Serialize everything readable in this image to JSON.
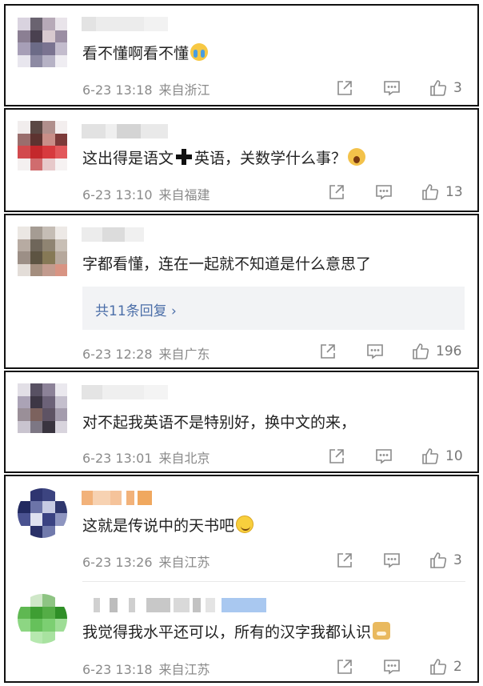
{
  "comments": [
    {
      "text": "看不懂啊看不懂",
      "emoji": "loudly-crying-face",
      "date": "6-23 13:18",
      "location": "来自浙江",
      "likes": "3"
    },
    {
      "text_before": "这出得是语文",
      "text_after": "英语，关数学什么事？",
      "symbol": "heavy-plus-sign",
      "emoji": "face-screaming",
      "date": "6-23 13:10",
      "location": "来自福建",
      "likes": "13"
    },
    {
      "text": "字都看懂，连在一起就不知道是什么意思了",
      "reply_link": "共11条回复",
      "reply_chevron": "›",
      "date": "6-23 12:28",
      "location": "来自广东",
      "likes": "196"
    },
    {
      "text": "对不起我英语不是特别好，换中文的来，",
      "date": "6-23 13:01",
      "location": "来自北京",
      "likes": "10"
    },
    {
      "text": "这就是传说中的天书吧",
      "emoji": "smiling-face",
      "date": "6-23 13:26",
      "location": "来自江苏",
      "likes": "3"
    },
    {
      "text": "我觉得我水平还可以，所有的汉字我都认识",
      "emoji": "doge",
      "date": "6-23 13:18",
      "location": "来自江苏",
      "likes": "2"
    }
  ],
  "icons": {
    "share": "share-icon",
    "comment": "comment-icon",
    "like": "thumbs-up-icon"
  },
  "colors": {
    "link": "#4b6ea8",
    "meta": "#8a8a8a",
    "reply_bg": "#f2f3f5"
  }
}
